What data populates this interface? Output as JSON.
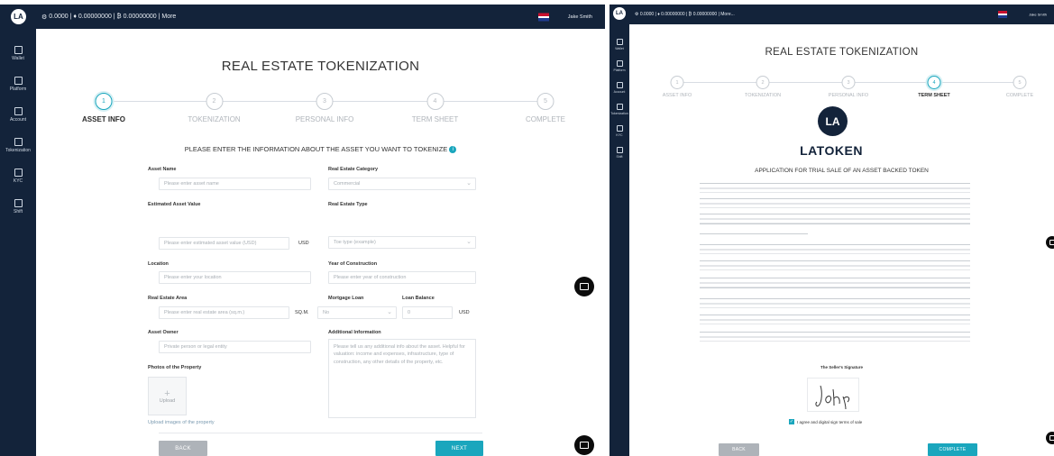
{
  "colors": {
    "sidebar": "#13233a",
    "accent": "#1aa6bd",
    "back_button": "#aeb3b9",
    "chat": "#0c0c0c"
  },
  "topbar": {
    "balances": "0.0000  |  ♦ 0.00000000  |  ₿ 0.00000000  |  More",
    "user": "Jake Smith",
    "right_balances": "0.0000  |  ♦ 0.00000000  |  ₿ 0.00000000  |  More..."
  },
  "sidebar": {
    "items": [
      {
        "label": "Wallet",
        "icon": "wallet-icon"
      },
      {
        "label": "Platform",
        "icon": "chart-icon"
      },
      {
        "label": "Account",
        "icon": "user-icon"
      },
      {
        "label": "Tokenization",
        "icon": "document-icon"
      },
      {
        "label": "KYC",
        "icon": "id-icon"
      },
      {
        "label": "Shift",
        "icon": "swap-icon"
      }
    ]
  },
  "title": "REAL ESTATE TOKENIZATION",
  "steps": [
    {
      "number": "1",
      "label": "ASSET INFO"
    },
    {
      "number": "2",
      "label": "TOKENIZATION"
    },
    {
      "number": "3",
      "label": "PERSONAL INFO"
    },
    {
      "number": "4",
      "label": "TERM SHEET"
    },
    {
      "number": "5",
      "label": "COMPLETE"
    }
  ],
  "left_active_step": 1,
  "right_active_step": 4,
  "form": {
    "heading": "PLEASE ENTER THE INFORMATION ABOUT THE ASSET YOU WANT TO TOKENIZE",
    "asset_name": {
      "label": "Asset Name",
      "placeholder": "Please enter asset name"
    },
    "category": {
      "label": "Real Estate Category",
      "value": "Commercial"
    },
    "value": {
      "label": "Estimated Asset Value",
      "placeholder": "Please enter estimated asset value (USD)",
      "unit": "USD"
    },
    "type": {
      "label": "Real Estate Type",
      "value": "Toe type (example)"
    },
    "location": {
      "label": "Location",
      "placeholder": "Please enter your location"
    },
    "year": {
      "label": "Year of Construction",
      "placeholder": "Please enter year of construction"
    },
    "area": {
      "label": "Real Estate Area",
      "placeholder": "Please enter real estate area (sq.m.)",
      "unit": "SQ.M."
    },
    "mortgage": {
      "label": "Mortgage Loan",
      "value": "No"
    },
    "balance": {
      "label": "Loan Balance",
      "placeholder": "0",
      "unit": "USD"
    },
    "owner": {
      "label": "Asset Owner",
      "placeholder": "Private person or legal entity"
    },
    "additional": {
      "label": "Additional Information",
      "placeholder": "Please tell us any additional info about the asset. Helpful for valuation: income and expenses, infrastructure, type of construction, any other details of the property, etc."
    },
    "photos_label": "Photos of the Property",
    "upload_label": "Upload",
    "upload_hint": "Upload images of the property",
    "back_label": "BACK",
    "next_label": "NEXT"
  },
  "term_sheet": {
    "logo_letters": "LA",
    "brand": "LATOKEN",
    "heading": "APPLICATION FOR TRIAL SALE OF AN ASSET BACKED TOKEN",
    "signature_label": "The Seller's Signature",
    "agree_label": "I agree and digital sign terms of sale",
    "back_label": "BACK",
    "complete_label": "COMPLETE"
  }
}
